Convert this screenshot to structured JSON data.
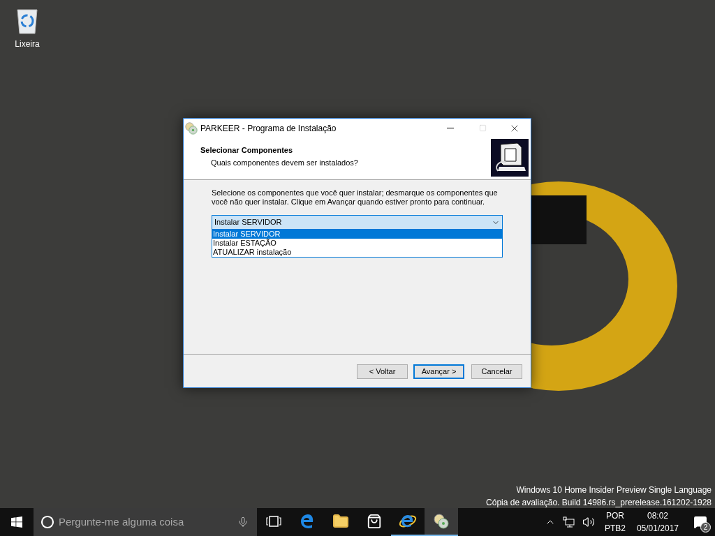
{
  "desktop": {
    "icons": [
      {
        "label": "Lixeira"
      }
    ],
    "watermark": [
      "Windows 10 Home Insider Preview Single Language",
      "Cópia de avaliação. Build 14986.rs_prerelease.161202-1928"
    ]
  },
  "window": {
    "title": "PARKEER - Programa de Instalação",
    "heading": "Selecionar Componentes",
    "subheading": "Quais componentes devem ser instalados?",
    "instructions": "Selecione os componentes que você quer instalar; desmarque os componentes que\nvocê não quer instalar. Clique em Avançar quando estiver pronto para continuar.",
    "dropdown": {
      "value": "Instalar SERVIDOR",
      "expanded": true,
      "options": [
        {
          "label": "Instalar SERVIDOR",
          "selected": true
        },
        {
          "label": "Instalar ESTAÇÃO",
          "selected": false
        },
        {
          "label": "ATUALIZAR instalação",
          "selected": false
        }
      ]
    },
    "buttons": [
      {
        "label": "< Voltar",
        "default": false
      },
      {
        "label": "Avançar >",
        "default": true
      },
      {
        "label": "Cancelar",
        "default": false
      }
    ]
  },
  "taskbar": {
    "search_placeholder": "Pergunte-me alguma coisa",
    "apps": [
      {
        "kind": "taskview",
        "running": false,
        "active": false
      },
      {
        "kind": "edge",
        "running": false,
        "active": false
      },
      {
        "kind": "explorer",
        "running": false,
        "active": false
      },
      {
        "kind": "store",
        "running": false,
        "active": false
      },
      {
        "kind": "ie",
        "running": true,
        "active": false
      },
      {
        "kind": "installer",
        "running": true,
        "active": true
      }
    ],
    "language": [
      "POR",
      "PTB2"
    ],
    "time": "08:02",
    "date": "05/01/2017",
    "notifications": "2"
  }
}
